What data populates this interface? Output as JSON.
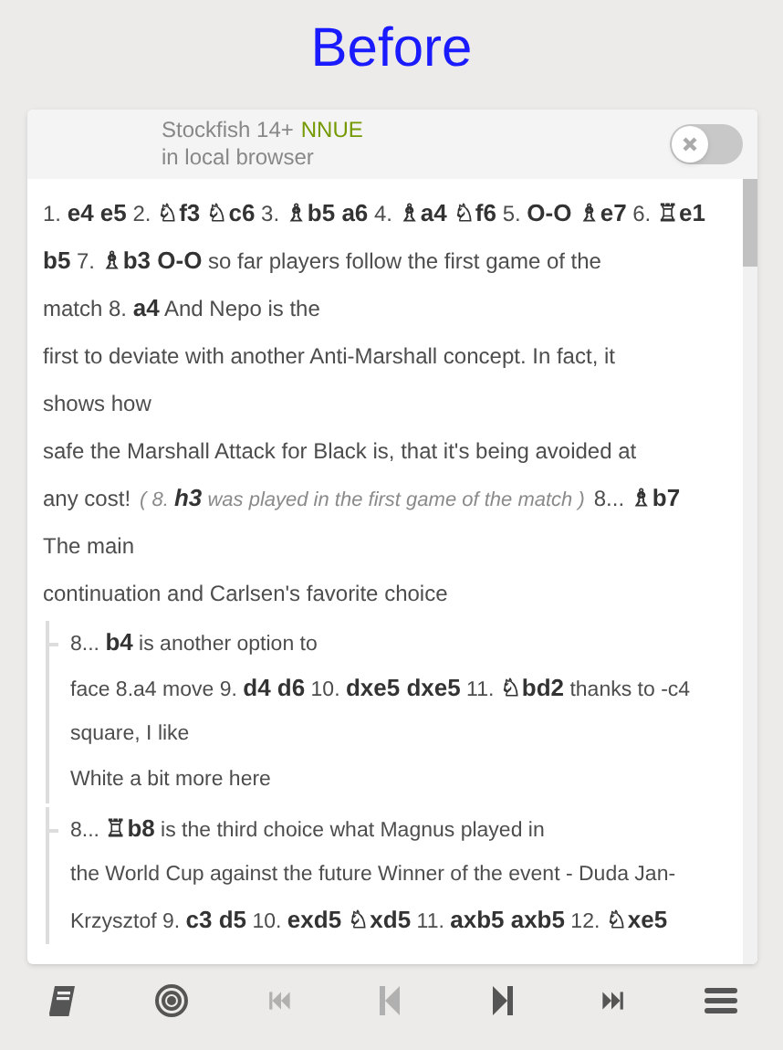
{
  "title": "Before",
  "engine": {
    "name": "Stockfish 14+",
    "badge": "NNUE",
    "location": "in local browser",
    "on": false
  },
  "mainline": [
    {
      "segments": [
        {
          "kind": "text",
          "text": "1. **e4 e5** 2. **♘f3 ♘c6** 3. **♗b5 a6** 4. **♗a4 ♘f6** 5. **O-O ♗e7** 6. **♖e1**"
        }
      ]
    },
    {
      "segments": [
        {
          "kind": "text",
          "text": "**b5** 7. **♗b3 O-O** so far players follow the first game of the"
        }
      ]
    },
    {
      "segments": [
        {
          "kind": "text",
          "text": "match 8. **a4** And Nepo is the"
        }
      ]
    },
    {
      "segments": [
        {
          "kind": "text",
          "text": "first to deviate with another Anti-Marshall concept. In fact, it"
        }
      ]
    },
    {
      "segments": [
        {
          "kind": "text",
          "text": "shows how"
        }
      ]
    },
    {
      "segments": [
        {
          "kind": "text",
          "text": "safe the Marshall Attack for Black is, that it's being avoided at"
        }
      ]
    },
    {
      "segments": [
        {
          "kind": "text",
          "text": "any cost!"
        },
        {
          "kind": "aside",
          "text": "( 8. **h3** was played in the first game of the match )"
        },
        {
          "kind": "text",
          "text": "8... **♗b7**"
        }
      ]
    },
    {
      "segments": [
        {
          "kind": "text",
          "text": "The main"
        }
      ]
    },
    {
      "segments": [
        {
          "kind": "text",
          "text": "continuation and Carlsen's favorite choice"
        }
      ]
    }
  ],
  "variations": [
    {
      "lines": [
        "8... **b4** is another option to",
        "face 8.a4 move 9. **d4 d6** 10. **dxe5 dxe5** 11. **♘bd2** thanks to -c4",
        "square, I like",
        "White a bit more here"
      ]
    },
    {
      "lines": [
        "8... **♖b8** is the third choice what Magnus played in",
        "the World Cup against the future Winner of the event - Duda Jan-",
        "Krzysztof 9. **c3 d5** 10. **exd5 ♘xd5** 11. **axb5 axb5** 12. **♘xe5**"
      ]
    }
  ],
  "toolbar": [
    {
      "kind": "book",
      "disabled": false
    },
    {
      "kind": "target",
      "disabled": false
    },
    {
      "kind": "first",
      "disabled": true
    },
    {
      "kind": "prev",
      "disabled": true
    },
    {
      "kind": "next",
      "disabled": false
    },
    {
      "kind": "last",
      "disabled": false
    },
    {
      "kind": "menu",
      "disabled": false
    }
  ]
}
